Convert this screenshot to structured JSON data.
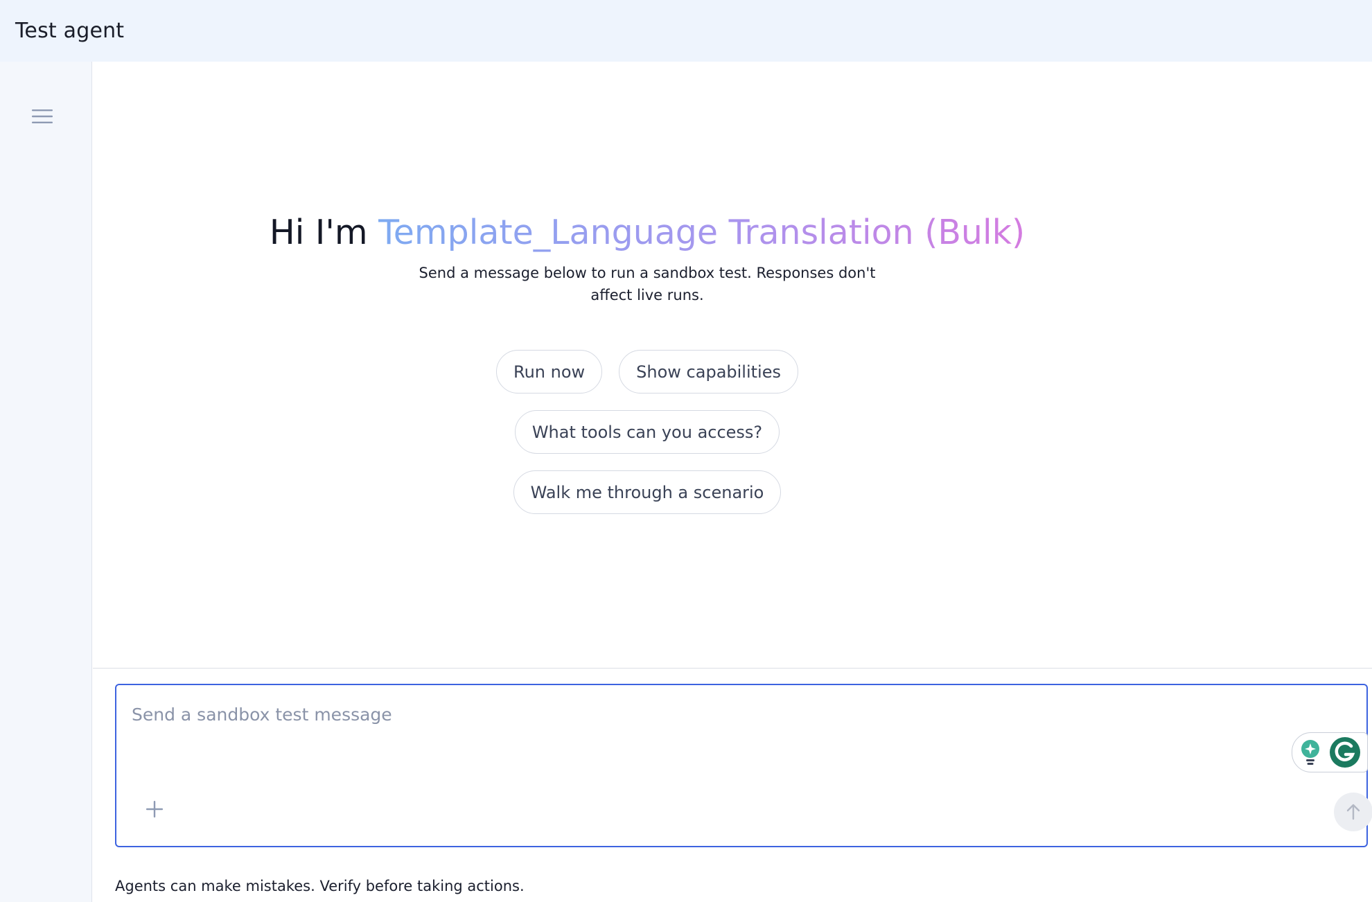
{
  "header": {
    "title": "Test agent"
  },
  "sidebar": {
    "menu_icon": "hamburger-menu-icon"
  },
  "hero": {
    "greeting_prefix": "Hi I'm ",
    "agent_name": "Template_Language Translation (Bulk)",
    "subtitle": "Send a message below to run a sandbox test. Responses don't affect live runs."
  },
  "suggestions": {
    "row1": [
      "Run now",
      "Show capabilities"
    ],
    "row2": [
      "What tools can you access?"
    ],
    "row3": [
      "Walk me through a scenario"
    ]
  },
  "composer": {
    "placeholder": "Send a sandbox test message",
    "value": "",
    "add_icon": "plus-icon",
    "send_icon": "arrow-up-icon",
    "extension_icons": [
      "lightbulb-icon",
      "grammarly-icon"
    ]
  },
  "footer": {
    "disclaimer": "Agents can make mistakes. Verify before taking actions."
  },
  "colors": {
    "header_bg": "#eef4fd",
    "sidebar_bg": "#f4f7fc",
    "composer_border": "#3d63e0",
    "gradient_start": "#7eaaf1",
    "gradient_end": "#d47be0"
  }
}
